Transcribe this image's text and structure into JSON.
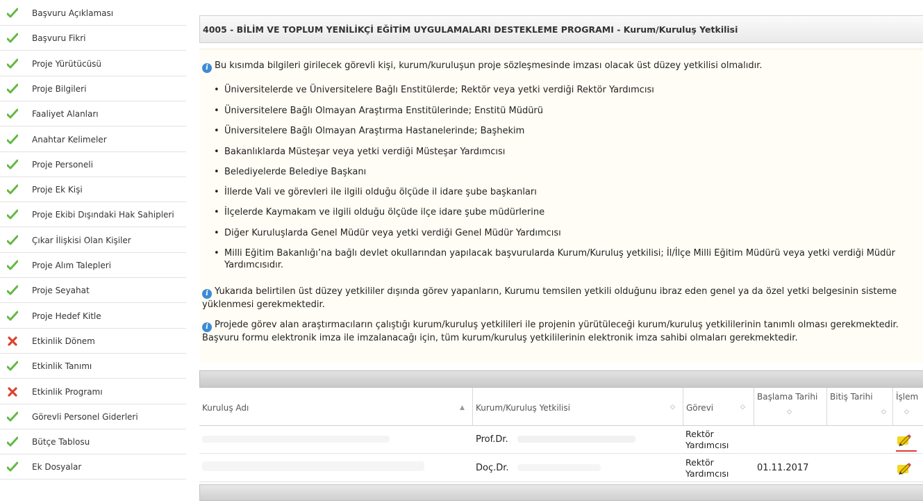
{
  "sidebar": {
    "items": [
      {
        "label": "Başvuru Açıklaması",
        "status": "done"
      },
      {
        "label": "Başvuru Fikri",
        "status": "done"
      },
      {
        "label": "Proje Yürütücüsü",
        "status": "done"
      },
      {
        "label": "Proje Bilgileri",
        "status": "done"
      },
      {
        "label": "Faaliyet Alanları",
        "status": "done"
      },
      {
        "label": "Anahtar Kelimeler",
        "status": "done"
      },
      {
        "label": "Proje Personeli",
        "status": "done"
      },
      {
        "label": "Proje Ek Kişi",
        "status": "done"
      },
      {
        "label": "Proje Ekibi Dışındaki Hak Sahipleri",
        "status": "done"
      },
      {
        "label": "Çıkar İlişkisi Olan Kişiler",
        "status": "done"
      },
      {
        "label": "Proje Alım Talepleri",
        "status": "done"
      },
      {
        "label": "Proje Seyahat",
        "status": "done"
      },
      {
        "label": "Proje Hedef Kitle",
        "status": "done"
      },
      {
        "label": "Etkinlik Dönem",
        "status": "error"
      },
      {
        "label": "Etkinlik Tanımı",
        "status": "done"
      },
      {
        "label": "Etkinlik Programı",
        "status": "error"
      },
      {
        "label": "Görevli Personel Giderleri",
        "status": "done"
      },
      {
        "label": "Bütçe Tablosu",
        "status": "done"
      },
      {
        "label": "Ek Dosyalar",
        "status": "done"
      }
    ],
    "icons": {
      "done": "green-check-icon",
      "error": "red-x-icon"
    },
    "colors": {
      "done": "#63b844",
      "error": "#d9442e"
    }
  },
  "main": {
    "title": "4005 - BİLİM VE TOPLUM YENİLİKÇİ EĞİTİM UYGULAMALARI DESTEKLEME PROGRAMI - Kurum/Kuruluş Yetkilisi",
    "info": {
      "intro": "Bu kısımda bilgileri girilecek görevli kişi, kurum/kuruluşun proje sözleşmesinde imzası olacak üst düzey yetkilisi olmalıdır.",
      "bullets": [
        "Üniversitelerde ve Üniversitelere Bağlı Enstitülerde; Rektör veya yetki verdiği Rektör Yardımcısı",
        "Üniversitelere Bağlı Olmayan Araştırma Enstitülerinde; Enstitü Müdürü",
        "Üniversitelere Bağlı Olmayan Araştırma Hastanelerinde; Başhekim",
        "Bakanlıklarda Müsteşar veya yetki verdiği Müsteşar Yardımcısı",
        "Belediyelerde Belediye Başkanı",
        "İllerde Vali ve görevleri ile ilgili olduğu ölçüde il idare şube başkanları",
        "İlçelerde Kaymakam ve ilgili olduğu ölçüde ilçe idare şube müdürlerine",
        "Diğer Kuruluşlarda Genel Müdür veya yetki verdiği Genel Müdür Yardımcısı",
        "Milli Eğitim Bakanlığı’na bağlı devlet okullarından yapılacak başvurularda Kurum/Kuruluş yetkilisi; İl/İlçe Milli Eğitim Müdürü veya yetki verdiği Müdür Yardımcısıdır."
      ],
      "note1": "Yukarıda belirtilen üst düzey yetkililer dışında görev yapanların, Kurumu temsilen yetkili olduğunu ibraz eden genel ya da özel yetki belgesinin sisteme yüklenmesi gerekmektedir.",
      "note2": "Projede görev alan araştırmacıların çalıştığı kurum/kuruluş yetkilileri ile projenin yürütüleceği kurum/kuruluş yetkililerinin tanımlı olması gerekmektedir. Başvuru formu elektronik imza ile imzalanacağı için, tüm kurum/kuruluş yetkililerinin elektronik imza sahibi olmaları gerekmektedir."
    },
    "grid": {
      "columns": [
        "Kuruluş Adı",
        "Kurum/Kuruluş Yetkilisi",
        "Görevi",
        "Başlama Tarihi",
        "Bitiş Tarihi",
        "İşlem"
      ],
      "rows": [
        {
          "kurulus": "",
          "yetkili": "Prof.Dr.",
          "gorevi": "Rektör Yardımcısı",
          "baslama": "",
          "bitis": ""
        },
        {
          "kurulus": "",
          "yetkili": "Doç.Dr.",
          "gorevi": "Rektör Yardımcısı",
          "baslama": "01.11.2017",
          "bitis": ""
        }
      ],
      "edit_icon": "pencil-edit-icon"
    }
  }
}
